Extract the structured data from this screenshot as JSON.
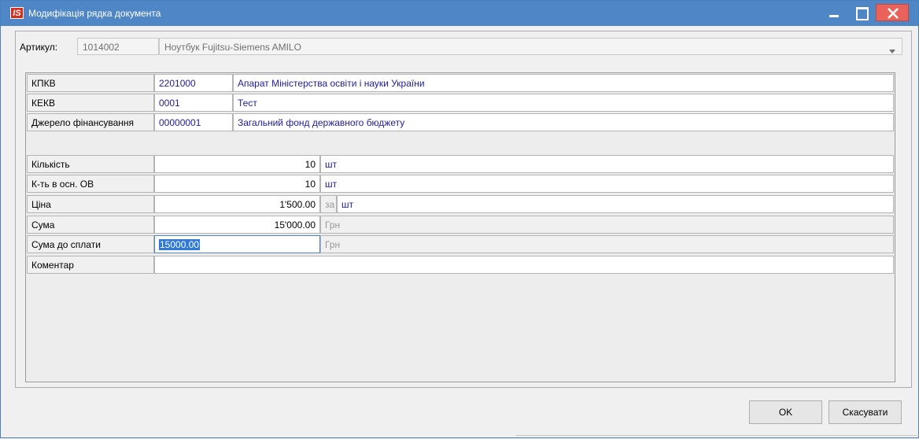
{
  "window": {
    "title": "Модифікація рядка документа",
    "logo": "IS",
    "icons": {
      "minimize": "minimize-icon",
      "maximize": "maximize-icon",
      "close": "close-icon"
    }
  },
  "article": {
    "label": "Артикул:",
    "code": "1014002",
    "name": "Ноутбук Fujitsu-Siemens AMILO"
  },
  "budget": [
    {
      "label": "КПКВ",
      "code": "2201000",
      "name": "Апарат Міністерства освіти і науки України"
    },
    {
      "label": "КЕКВ",
      "code": "0001",
      "name": "Тест"
    },
    {
      "label": "Джерело фінансування",
      "code": "00000001",
      "name": "Загальний фонд державного бюджету"
    }
  ],
  "fields": {
    "quantity": {
      "label": "Кількість",
      "value": "10",
      "unit": "шт"
    },
    "quantity_os": {
      "label": "К-ть в осн. ОВ",
      "value": "10",
      "unit": "шт"
    },
    "price": {
      "label": "Ціна",
      "value": "1'500.00",
      "per": "за",
      "unit": "шт"
    },
    "sum": {
      "label": "Сума",
      "value": "15'000.00",
      "unit": "Грн"
    },
    "sum_to_pay": {
      "label": "Сума до сплати",
      "value": "15000.00",
      "unit": "Грн"
    },
    "comment": {
      "label": "Коментар",
      "value": ""
    }
  },
  "buttons": {
    "ok": "OK",
    "cancel": "Скасувати"
  },
  "colors": {
    "titlebar": "#4f86c6",
    "close": "#e9635a",
    "link_text": "#1d1d9e",
    "selection": "#3079d6"
  }
}
